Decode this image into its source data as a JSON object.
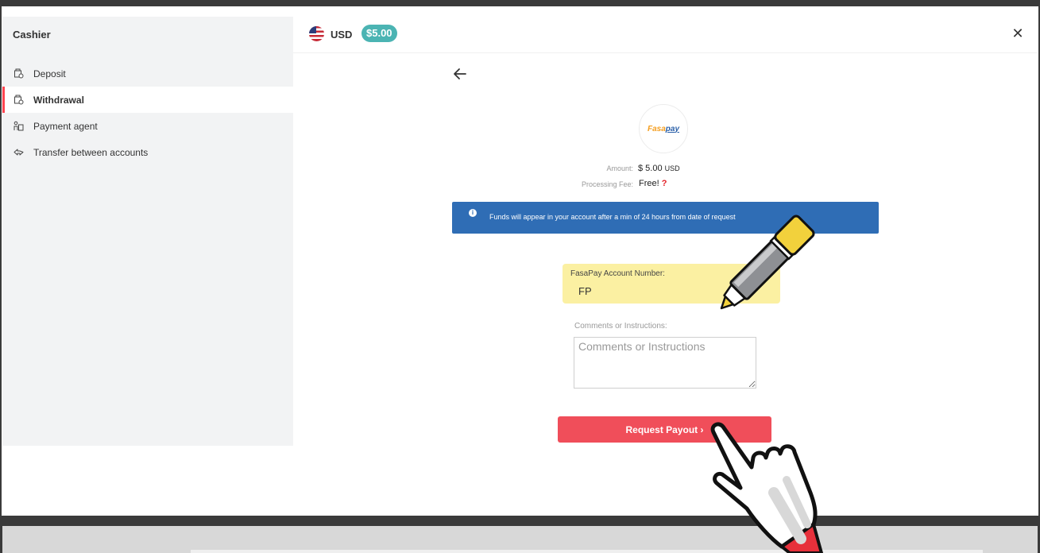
{
  "sidebar": {
    "title": "Cashier",
    "items": [
      {
        "label": "Deposit",
        "icon": "deposit-icon"
      },
      {
        "label": "Withdrawal",
        "icon": "withdrawal-icon",
        "active": true
      },
      {
        "label": "Payment agent",
        "icon": "payment-agent-icon"
      },
      {
        "label": "Transfer between accounts",
        "icon": "transfer-icon"
      }
    ]
  },
  "header": {
    "currency": "USD",
    "balance": "$5.00",
    "close_icon": "close-icon"
  },
  "provider": {
    "logo_fasa": "Fasa",
    "logo_pay": "pay"
  },
  "summary": {
    "amount_label": "Amount:",
    "amount_value": "$ 5.00",
    "amount_currency": "USD",
    "fee_label": "Processing Fee:",
    "fee_value": "Free!",
    "fee_help": "?"
  },
  "notice": {
    "text": "Funds will appear in your account after a min of 24 hours from date of request"
  },
  "form": {
    "account_label": "FasaPay Account Number:",
    "account_value": "FP",
    "comments_label": "Comments or Instructions:",
    "comments_placeholder": "Comments or Instructions",
    "submit_label": "Request Payout ›"
  },
  "colors": {
    "accent": "#ff444f",
    "balance_badge": "#4bb4b3",
    "notice_bg": "#2f6db5",
    "submit_bg": "#f04e5a",
    "highlight": "#fbf0a2"
  }
}
